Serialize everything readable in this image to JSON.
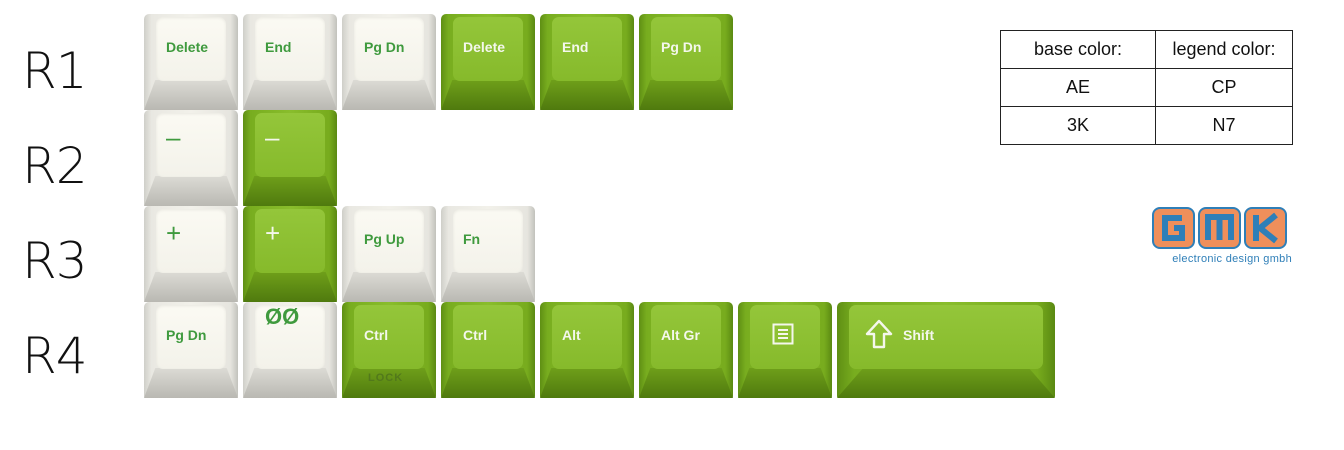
{
  "rows": [
    "R1",
    "R2",
    "R3",
    "R4"
  ],
  "keys": {
    "r1": [
      {
        "label": "Delete",
        "color": "white"
      },
      {
        "label": "End",
        "color": "white"
      },
      {
        "label": "Pg Dn",
        "color": "white"
      },
      {
        "label": "Delete",
        "color": "green"
      },
      {
        "label": "End",
        "color": "green"
      },
      {
        "label": "Pg Dn",
        "color": "green"
      }
    ],
    "r2": [
      {
        "label": "–",
        "color": "white"
      },
      {
        "label": "–",
        "color": "green"
      }
    ],
    "r3": [
      {
        "label": "+",
        "color": "white"
      },
      {
        "label": "+",
        "color": "green"
      },
      {
        "label": "Pg Up",
        "color": "white"
      },
      {
        "label": "Fn",
        "color": "white"
      }
    ],
    "r4": [
      {
        "label": "Pg Dn",
        "color": "white"
      },
      {
        "label": "ØØ",
        "color": "white"
      },
      {
        "label": "Ctrl",
        "sub": "LOCK",
        "color": "green"
      },
      {
        "label": "Ctrl",
        "color": "green"
      },
      {
        "label": "Alt",
        "color": "green"
      },
      {
        "label": "Alt Gr",
        "color": "green"
      },
      {
        "icon": "menu-icon",
        "color": "green"
      },
      {
        "label": "Shift",
        "icon": "shift-arrow-icon",
        "color": "green"
      }
    ]
  },
  "color_table": {
    "headers": [
      "base color:",
      "legend color:"
    ],
    "rows": [
      [
        "AE",
        "CP"
      ],
      [
        "3K",
        "N7"
      ]
    ]
  },
  "logo": {
    "letters": "GMK",
    "tagline": "electronic design gmbh"
  },
  "colors": {
    "green_base": "#86ba2b",
    "white_base": "#f2f1ea",
    "green_legend": "#3f9a3e",
    "logo_orange": "#ef8f5b",
    "logo_blue": "#2f7fb8"
  }
}
